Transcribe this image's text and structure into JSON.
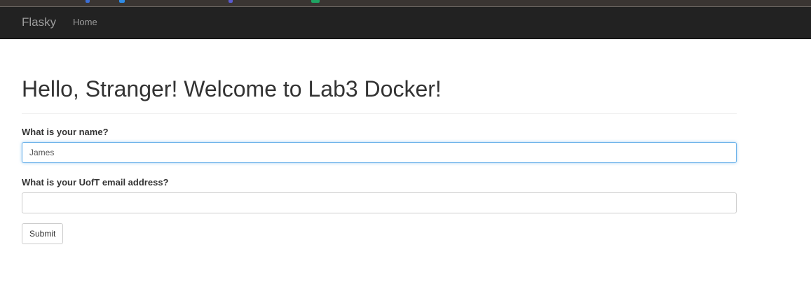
{
  "navbar": {
    "brand": "Flasky",
    "links": [
      {
        "label": "Home"
      }
    ]
  },
  "page": {
    "title": "Hello, Stranger! Welcome to Lab3 Docker!"
  },
  "form": {
    "name_field": {
      "label": "What is your name?",
      "value": "James"
    },
    "email_field": {
      "label": "What is your UofT email address?",
      "value": ""
    },
    "submit_label": "Submit"
  },
  "colors": {
    "navbar_bg": "#222222",
    "nav_text": "#9d9d9d",
    "focus_border": "#66afe9"
  }
}
